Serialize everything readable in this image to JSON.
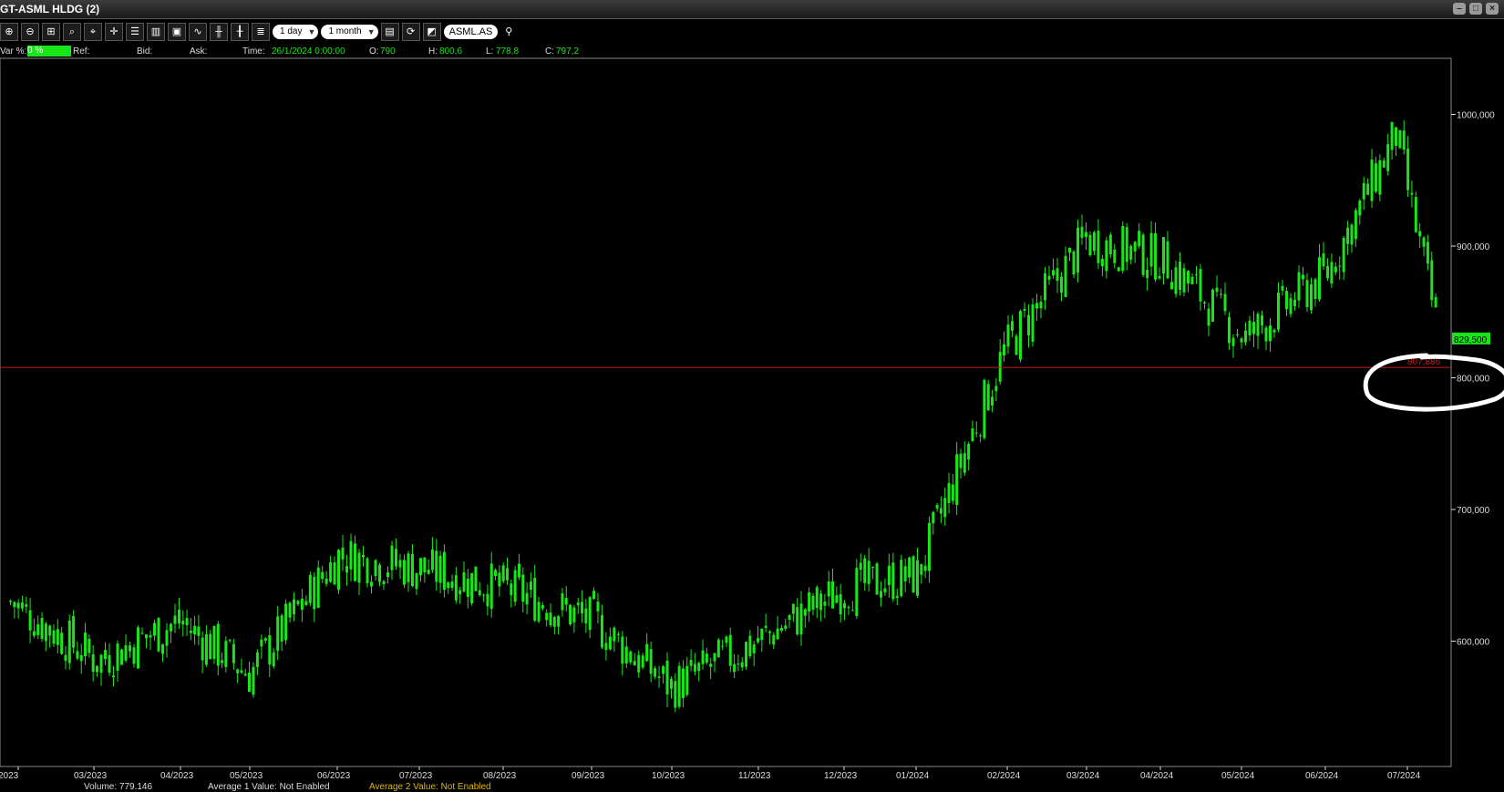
{
  "window": {
    "title": "GT-ASML HLDG (2)"
  },
  "toolbar": {
    "period_select": "1 day",
    "range_select": "1 month",
    "symbol": "ASML.AS",
    "icons": [
      "zoom-in-icon",
      "zoom-out-icon",
      "zoom-fit-icon",
      "zoom-area-icon",
      "zoom-reset-icon",
      "crosshair-icon",
      "grid-h-icon",
      "grid-v-icon",
      "chart-frame-icon",
      "line-chart-icon",
      "candlestick-icon",
      "bar-chart-icon",
      "properties-icon",
      "save-icon",
      "refresh-icon",
      "color-icon",
      "search-icon"
    ]
  },
  "infobar": {
    "var_label": "Var %:",
    "var_value": "0 %",
    "ref_label": "Ref:",
    "bid_label": "Bid:",
    "ask_label": "Ask:",
    "time_label": "Time:",
    "time_value": "26/1/2024 0:00:00",
    "o_label": "O:",
    "o_value": "790",
    "h_label": "H:",
    "h_value": "800,6",
    "l_label": "L:",
    "l_value": "778,8",
    "c_label": "C:",
    "c_value": "797,2"
  },
  "bottom": {
    "volume": "Volume: 779.146",
    "average1": "Average 1 Value: Not Enabled",
    "average2": "Average 2 Value: Not Enabled"
  },
  "colors": {
    "candle": "#19e619",
    "refline": "#cc1a1a",
    "axis": "#dddddd",
    "annotation": "#ffffff"
  },
  "chart_data": {
    "type": "candlestick",
    "x_ticks": [
      "2023",
      "03/2023",
      "04/2023",
      "05/2023",
      "06/2023",
      "07/2023",
      "08/2023",
      "09/2023",
      "10/2023",
      "11/2023",
      "12/2023",
      "01/2024",
      "02/2024",
      "03/2024",
      "04/2024",
      "05/2024",
      "06/2024",
      "07/2024"
    ],
    "y_ticks": [
      "600,000",
      "700,000",
      "800,000",
      "900,000",
      "1000,000"
    ],
    "ylim": [
      545,
      1045
    ],
    "last_price_label": "829,500",
    "last_price": 829.5,
    "ref_line_label": "807,886",
    "ref_line": 807.886,
    "monthly_anchors": [
      {
        "m": "02/2023",
        "v": 630
      },
      {
        "m": "03/2023",
        "v": 585
      },
      {
        "m": "04/2023",
        "v": 615
      },
      {
        "m": "05/2023",
        "v": 575
      },
      {
        "m": "06/2023",
        "v": 665
      },
      {
        "m": "07/2023",
        "v": 655
      },
      {
        "m": "08/2023",
        "v": 640
      },
      {
        "m": "09/2023",
        "v": 615
      },
      {
        "m": "10/2023",
        "v": 565
      },
      {
        "m": "11/2023",
        "v": 600
      },
      {
        "m": "12/2023",
        "v": 640
      },
      {
        "m": "01/2024",
        "v": 650
      },
      {
        "m": "02/2024",
        "v": 820
      },
      {
        "m": "03/2024",
        "v": 905
      },
      {
        "m": "04/2024",
        "v": 890
      },
      {
        "m": "05/2024",
        "v": 830
      },
      {
        "m": "06/2024",
        "v": 880
      },
      {
        "m": "07/2024",
        "v": 985
      },
      {
        "m": "07/2024 end",
        "v": 829.5
      }
    ]
  }
}
